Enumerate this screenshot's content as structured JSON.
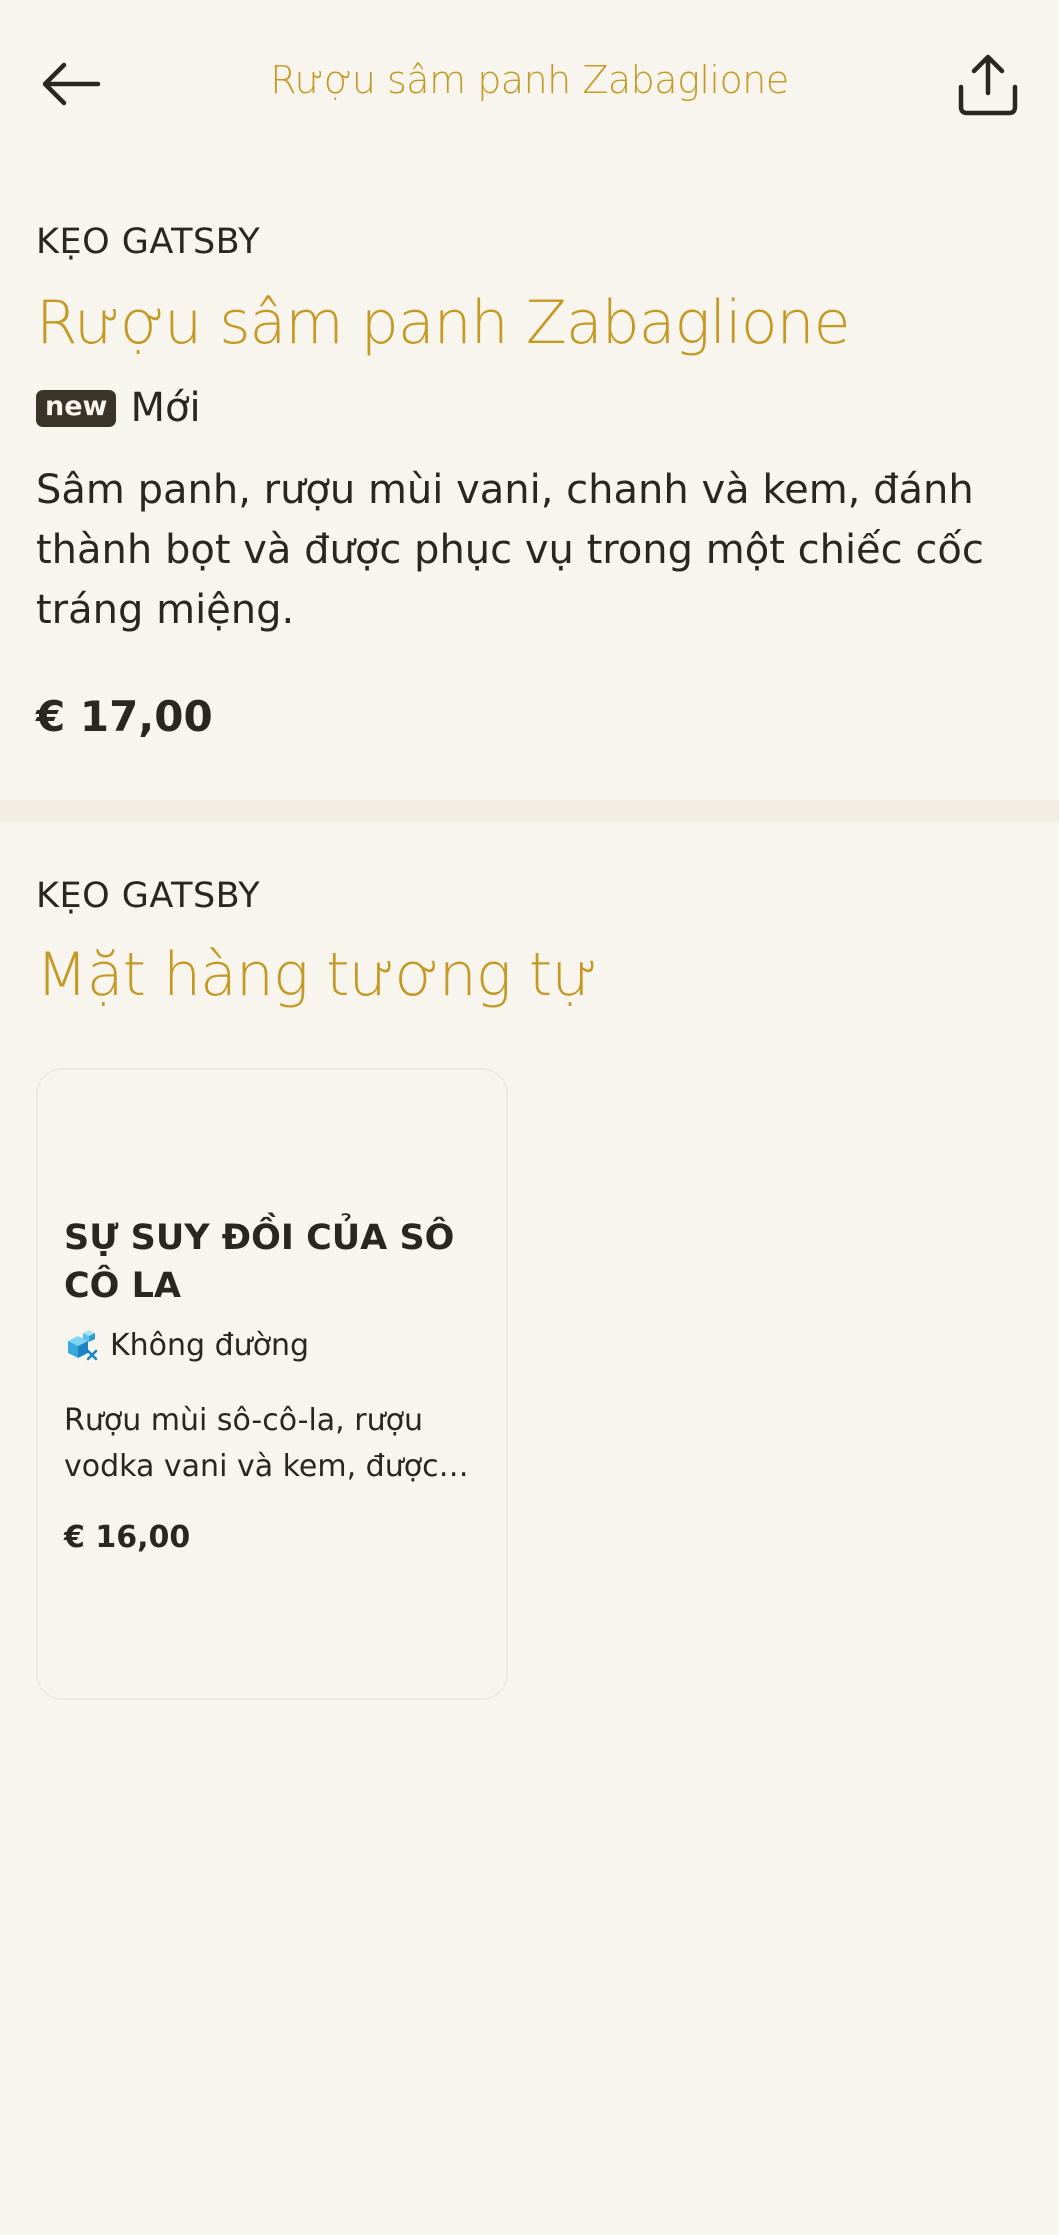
{
  "header": {
    "title": "Rượu sâm panh Zabaglione",
    "back_icon": "arrow-left-icon",
    "share_icon": "share-icon"
  },
  "product": {
    "brand": "KẸO GATSBY",
    "title": "Rượu sâm panh Zabaglione",
    "badge": "new",
    "badge_label": "Mới",
    "description": "Sâm panh, rượu mùi vani, chanh và kem, đánh thành bọt và được phục vụ trong một chiếc cốc tráng miệng.",
    "price": "€ 17,00"
  },
  "similar": {
    "brand": "KẸO GATSBY",
    "title": "Mặt hàng tương tự",
    "items": [
      {
        "title": "SỰ SUY ĐỒI CỦA SÔ CÔ LA",
        "tag_icon": "sugar-cube-icon",
        "tag": "Không đường",
        "description": "Rượu mùi sô-cô-la, rượu vodka vani và kem, được phục vụ",
        "price": "€ 16,00"
      }
    ]
  },
  "colors": {
    "accent": "#c49a25",
    "background": "#f8f5ef",
    "text": "#2b2620",
    "badge_bg": "#3a3428"
  }
}
